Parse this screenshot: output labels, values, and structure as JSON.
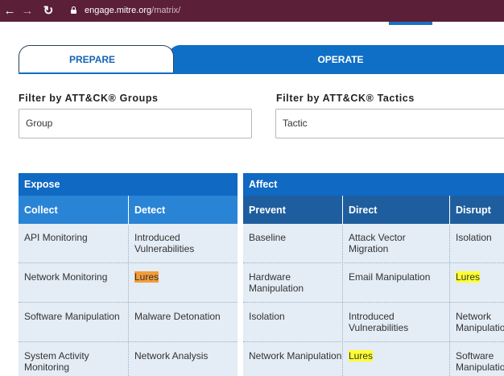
{
  "browser": {
    "domain": "engage.mitre.org",
    "path": "/matrix/"
  },
  "tabs": {
    "prepare": "PREPARE",
    "operate": "OPERATE"
  },
  "filters": {
    "groups_label": "Filter by ATT&CK® Groups",
    "groups_value": "Group",
    "tactics_label": "Filter by ATT&CK® Tactics",
    "tactics_value": "Tactic"
  },
  "matrix": {
    "goals": [
      "Expose",
      "Affect"
    ],
    "columns": [
      "Collect",
      "Detect",
      "Prevent",
      "Direct",
      "Disrupt"
    ],
    "rows": [
      [
        "API Monitoring",
        "Introduced Vulnerabilities",
        "Baseline",
        "Attack Vector Migration",
        "Isolation"
      ],
      [
        "Network Monitoring",
        "Lures",
        "Hardware Manipulation",
        "Email Manipulation",
        "Lures"
      ],
      [
        "Software Manipulation",
        "Malware Detonation",
        "Isolation",
        "Introduced Vulnerabilities",
        "Network Manipulation"
      ],
      [
        "System Activity Monitoring",
        "Network Analysis",
        "Network Manipulation",
        "Lures",
        "Software Manipulation"
      ]
    ],
    "highlight_colors": {
      "orange": "#f49d39",
      "yellow": "#ffff33"
    }
  }
}
